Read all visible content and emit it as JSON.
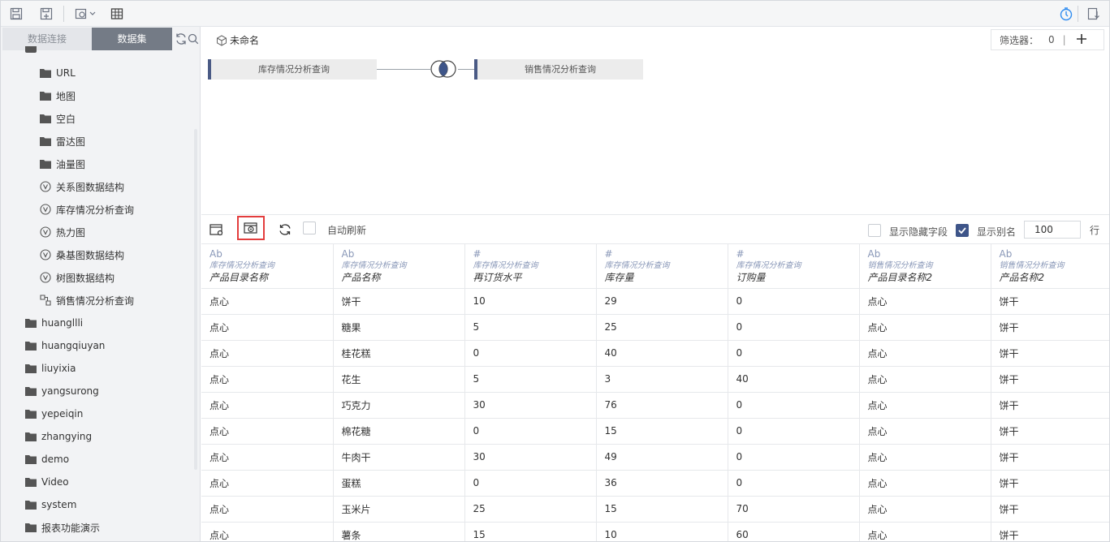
{
  "toolbar": {
    "left_icons": [
      "save-icon",
      "save-as-icon",
      "dataset-dropdown-icon",
      "table-icon"
    ],
    "right_icons": [
      "timer-icon",
      "export-icon"
    ]
  },
  "sidebar": {
    "tabs": [
      {
        "label": "数据连接",
        "active": false
      },
      {
        "label": "数据集",
        "active": true
      }
    ],
    "tree": [
      {
        "label": "URL",
        "type": "folder",
        "indent": 2
      },
      {
        "label": "地图",
        "type": "folder",
        "indent": 2
      },
      {
        "label": "空白",
        "type": "folder",
        "indent": 2
      },
      {
        "label": "雷达图",
        "type": "folder",
        "indent": 2
      },
      {
        "label": "油量图",
        "type": "folder",
        "indent": 2
      },
      {
        "label": "关系图数据结构",
        "type": "query",
        "indent": 2
      },
      {
        "label": "库存情况分析查询",
        "type": "query",
        "indent": 2
      },
      {
        "label": "热力图",
        "type": "query",
        "indent": 2
      },
      {
        "label": "桑基图数据结构",
        "type": "query",
        "indent": 2
      },
      {
        "label": "树图数据结构",
        "type": "query",
        "indent": 2
      },
      {
        "label": "销售情况分析查询",
        "type": "combined",
        "indent": 2
      },
      {
        "label": "huangllli",
        "type": "folder",
        "indent": 1
      },
      {
        "label": "huangqiuyan",
        "type": "folder",
        "indent": 1
      },
      {
        "label": "liuyixia",
        "type": "folder",
        "indent": 1
      },
      {
        "label": "yangsurong",
        "type": "folder",
        "indent": 1
      },
      {
        "label": "yepeiqin",
        "type": "folder",
        "indent": 1
      },
      {
        "label": "zhangying",
        "type": "folder",
        "indent": 1
      },
      {
        "label": "demo",
        "type": "folder",
        "indent": 1
      },
      {
        "label": "Video",
        "type": "folder",
        "indent": 1
      },
      {
        "label": "system",
        "type": "folder",
        "indent": 1
      },
      {
        "label": "报表功能演示",
        "type": "folder",
        "indent": 1
      }
    ]
  },
  "canvas": {
    "dataset_name": "未命名",
    "filter_label": "筛选器：",
    "filter_count": "0",
    "filter_sep": "|",
    "left_node": "库存情况分析查询",
    "right_node": "销售情况分析查询",
    "join_type": "inner-join-icon"
  },
  "preview_bar": {
    "auto_refresh_label": "自动刷新",
    "auto_refresh_checked": false,
    "show_hidden_label": "显示隐藏字段",
    "show_hidden_checked": false,
    "show_alias_label": "显示别名",
    "show_alias_checked": true,
    "row_count": "100",
    "row_unit": "行"
  },
  "table": {
    "columns": [
      {
        "type": "Ab",
        "source": "库存情况分析查询",
        "name": "产品目录名称"
      },
      {
        "type": "Ab",
        "source": "库存情况分析查询",
        "name": "产品名称"
      },
      {
        "type": "#",
        "source": "库存情况分析查询",
        "name": "再订货水平"
      },
      {
        "type": "#",
        "source": "库存情况分析查询",
        "name": "库存量"
      },
      {
        "type": "#",
        "source": "库存情况分析查询",
        "name": "订购量"
      },
      {
        "type": "Ab",
        "source": "销售情况分析查询",
        "name": "产品目录名称2"
      },
      {
        "type": "Ab",
        "source": "销售情况分析查询",
        "name": "产品名称2"
      }
    ],
    "rows": [
      [
        "点心",
        "饼干",
        "10",
        "29",
        "0",
        "点心",
        "饼干"
      ],
      [
        "点心",
        "糖果",
        "5",
        "25",
        "0",
        "点心",
        "饼干"
      ],
      [
        "点心",
        "桂花糕",
        "0",
        "40",
        "0",
        "点心",
        "饼干"
      ],
      [
        "点心",
        "花生",
        "5",
        "3",
        "40",
        "点心",
        "饼干"
      ],
      [
        "点心",
        "巧克力",
        "30",
        "76",
        "0",
        "点心",
        "饼干"
      ],
      [
        "点心",
        "棉花糖",
        "0",
        "15",
        "0",
        "点心",
        "饼干"
      ],
      [
        "点心",
        "牛肉干",
        "30",
        "49",
        "0",
        "点心",
        "饼干"
      ],
      [
        "点心",
        "蛋糕",
        "0",
        "36",
        "0",
        "点心",
        "饼干"
      ],
      [
        "点心",
        "玉米片",
        "25",
        "15",
        "70",
        "点心",
        "饼干"
      ],
      [
        "点心",
        "薯条",
        "15",
        "10",
        "60",
        "点心",
        "饼干"
      ]
    ]
  },
  "colors": {
    "accent": "#3e5589",
    "active_tab": "#747b86",
    "highlight_border": "#e33d3d",
    "timer_icon": "#2f8cf0"
  }
}
